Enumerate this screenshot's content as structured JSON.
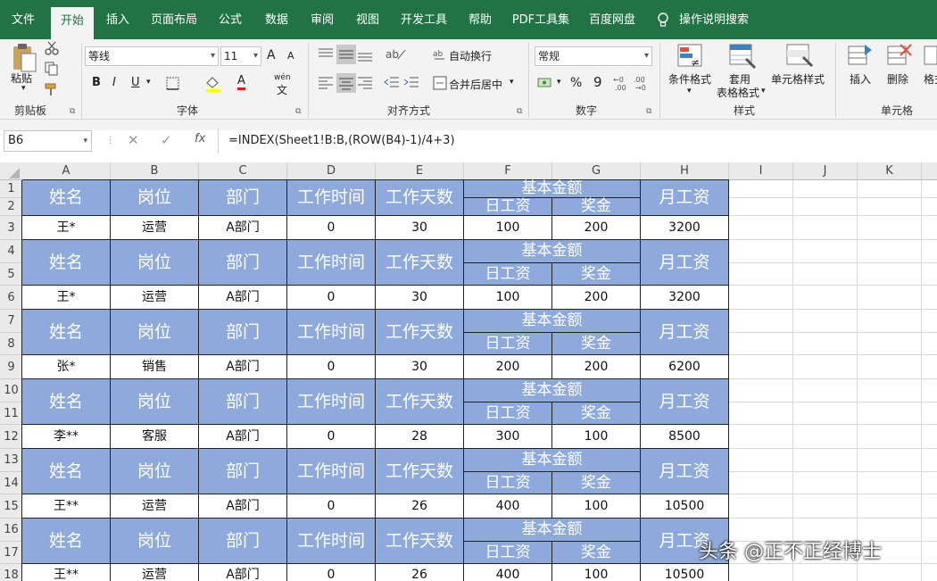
{
  "tabs": [
    "文件",
    "开始",
    "插入",
    "页面布局",
    "公式",
    "数据",
    "审阅",
    "视图",
    "开发工具",
    "帮助",
    "PDF工具集",
    "百度网盘",
    "操作说明搜索"
  ],
  "ribbon": {
    "clipboard": {
      "paste": "粘贴",
      "label": "剪贴板"
    },
    "font": {
      "name": "等线",
      "size": "11",
      "label": "字体",
      "bold": "B",
      "italic": "I",
      "underline": "U",
      "grow": "A",
      "shrink": "A",
      "wen": "wén"
    },
    "alignment": {
      "wrap": "自动换行",
      "merge": "合并后居中",
      "label": "对齐方式"
    },
    "number": {
      "format": "常规",
      "percent": "%",
      "comma": "9",
      "label": "数字"
    },
    "styles": {
      "conditional": "条件格式",
      "table1": "套用",
      "table2": "表格格式",
      "cell": "单元格样式",
      "label": "样式"
    },
    "cells": {
      "insert": "插入",
      "delete": "删除",
      "format": "格式",
      "label": "单元格"
    }
  },
  "formula_bar": {
    "name_box": "B6",
    "formula": "=INDEX(Sheet1!B:B,(ROW(B4)-1)/4+3)",
    "fx": "fx"
  },
  "columns": [
    "A",
    "B",
    "C",
    "D",
    "E",
    "F",
    "G",
    "H",
    "I",
    "J",
    "K"
  ],
  "rows": [
    "1",
    "2",
    "3",
    "4",
    "5",
    "6",
    "7",
    "8",
    "9",
    "10",
    "11",
    "12",
    "13",
    "14",
    "15",
    "16",
    "17",
    "18"
  ],
  "header": {
    "name": "姓名",
    "post": "岗位",
    "dept": "部门",
    "hours": "工作时间",
    "days": "工作天数",
    "base": "基本金额",
    "daily": "日工资",
    "bonus": "奖金",
    "monthly": "月工资"
  },
  "records": [
    [
      "王*",
      "运营",
      "A部门",
      "0",
      "30",
      "100",
      "200",
      "3200"
    ],
    [
      "王*",
      "运营",
      "A部门",
      "0",
      "30",
      "100",
      "200",
      "3200"
    ],
    [
      "张*",
      "销售",
      "A部门",
      "0",
      "30",
      "200",
      "200",
      "6200"
    ],
    [
      "李**",
      "客服",
      "A部门",
      "0",
      "28",
      "300",
      "100",
      "8500"
    ],
    [
      "王**",
      "运营",
      "A部门",
      "0",
      "26",
      "400",
      "100",
      "10500"
    ],
    [
      "王**",
      "运营",
      "A部门",
      "0",
      "26",
      "400",
      "100",
      "10500"
    ]
  ],
  "watermark": "头条 @正不正经博士",
  "colors": {
    "accent": "#217346",
    "header_fill": "#8ea9db"
  }
}
